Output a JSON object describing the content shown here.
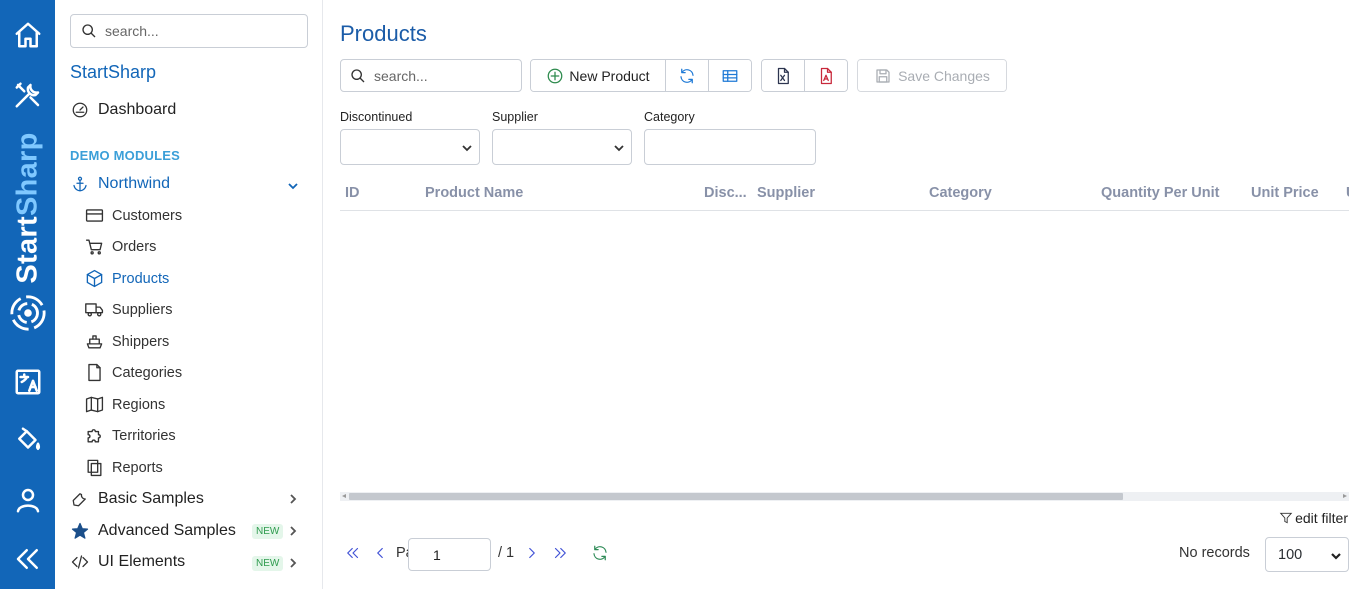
{
  "colors": {
    "rail": "#1266b8",
    "accent": "#1266b8",
    "brand_light": "#7fc8ff",
    "section": "#3b9fd8",
    "header_text": "#8891a8",
    "new_badge": "#2e9b4e"
  },
  "rail": {
    "brand_part1": "Start",
    "brand_part2": "Sharp",
    "icons": [
      "home-icon",
      "tools-icon",
      "translate-icon",
      "paint-bucket-icon",
      "user-icon",
      "collapse-icon"
    ]
  },
  "sidebar": {
    "search_placeholder": "search...",
    "app_name": "StartSharp",
    "dashboard": "Dashboard",
    "section": "DEMO MODULES",
    "northwind": "Northwind",
    "items": [
      {
        "label": "Customers",
        "icon": "credit-card-icon"
      },
      {
        "label": "Orders",
        "icon": "cart-icon"
      },
      {
        "label": "Products",
        "icon": "box-icon"
      },
      {
        "label": "Suppliers",
        "icon": "truck-icon"
      },
      {
        "label": "Shippers",
        "icon": "ship-icon"
      },
      {
        "label": "Categories",
        "icon": "file-icon"
      },
      {
        "label": "Regions",
        "icon": "map-icon"
      },
      {
        "label": "Territories",
        "icon": "puzzle-icon"
      },
      {
        "label": "Reports",
        "icon": "copy-icon"
      }
    ],
    "basic_samples": "Basic Samples",
    "advanced_samples": "Advanced Samples",
    "ui_elements": "UI Elements",
    "new_badge": "NEW"
  },
  "main": {
    "title": "Products",
    "search_placeholder": "search...",
    "toolbar": {
      "new_product": "New Product",
      "save_changes": "Save Changes"
    },
    "filters": {
      "discontinued": "Discontinued",
      "supplier": "Supplier",
      "category": "Category"
    },
    "columns": [
      "ID",
      "Product Name",
      "Disc...",
      "Supplier",
      "Category",
      "Quantity Per Unit",
      "Unit Price",
      "U"
    ],
    "edit_filter": "edit filter",
    "pager": {
      "page_label": "Page",
      "page_value": "1",
      "total": "/ 1",
      "no_records": "No records",
      "page_size": "100"
    }
  }
}
